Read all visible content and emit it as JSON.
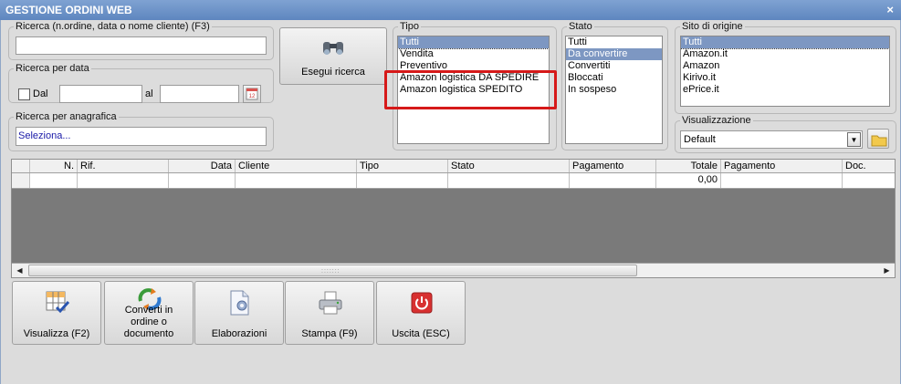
{
  "window": {
    "title": "GESTIONE ORDINI WEB",
    "close_glyph": "×"
  },
  "search": {
    "text_legend": "Ricerca (n.ordine, data o nome cliente) (F3)",
    "text_value": "",
    "date_legend": "Ricerca per data",
    "dal_label": "Dal",
    "dal_checked": false,
    "dal_value": "",
    "al_label": "al",
    "al_value": "",
    "calendar_icon": "calendar-icon",
    "anag_legend": "Ricerca per anagrafica",
    "anag_value": "Seleziona...",
    "button_label": "Esegui ricerca",
    "button_icon": "binoculars-icon"
  },
  "tipo": {
    "legend": "Tipo",
    "items": [
      "Tutti",
      "Vendita",
      "Preventivo",
      "Amazon logistica DA SPEDIRE",
      "Amazon logistica SPEDITO"
    ],
    "selected_index": 0
  },
  "stato": {
    "legend": "Stato",
    "items": [
      "Tutti",
      "Da convertire",
      "Convertiti",
      "Bloccati",
      "In sospeso"
    ],
    "selected_index": 1
  },
  "sito": {
    "legend": "Sito di origine",
    "items": [
      "Tutti",
      "Amazon.it",
      "Amazon",
      "Kirivo.it",
      "ePrice.it"
    ],
    "selected_index": 0
  },
  "visualizzazione": {
    "legend": "Visualizzazione",
    "value": "Default",
    "folder_icon": "folder-icon"
  },
  "grid": {
    "columns": [
      "N.",
      "Rif.",
      "Data",
      "Cliente",
      "Tipo",
      "Stato",
      "Pagamento",
      "Totale",
      "Pagamento",
      "Doc."
    ],
    "row": [
      "",
      "",
      "",
      "",
      "",
      "",
      "",
      "0,00",
      "",
      ""
    ]
  },
  "buttons": [
    {
      "label": "Visualizza (F2)",
      "icon": "table-check-icon"
    },
    {
      "label": "Converti in ordine o documento",
      "icon": "recycle-convert-icon"
    },
    {
      "label": "Elaborazioni",
      "icon": "document-gear-icon"
    },
    {
      "label": "Stampa (F9)",
      "icon": "printer-icon"
    },
    {
      "label": "Uscita (ESC)",
      "icon": "power-exit-icon"
    }
  ],
  "colors": {
    "selection": "#7d97c2",
    "highlight": "#d61919",
    "titlebar": "#6a8fc8",
    "grid_empty": "#7a7a7a"
  }
}
